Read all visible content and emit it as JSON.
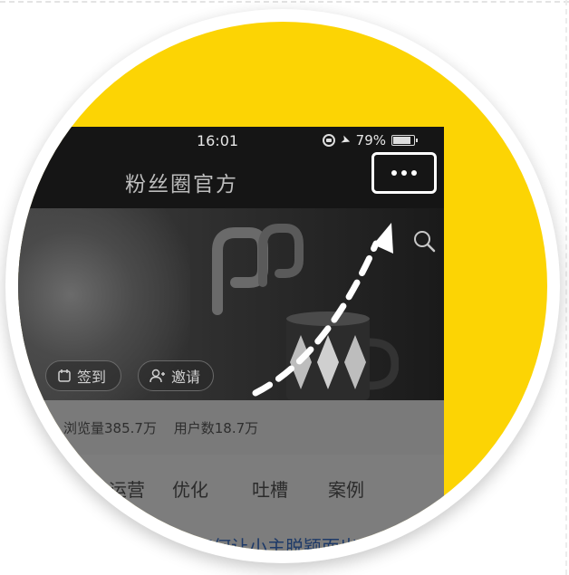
{
  "status_bar": {
    "time": "16:01",
    "battery": "79%"
  },
  "nav": {
    "title": "粉丝圈官方"
  },
  "actions": {
    "checkin": "签到",
    "invite": "邀请"
  },
  "stats": {
    "views": "浏览量385.7万",
    "users": "用户数18.7万"
  },
  "tabs": [
    "运营",
    "优化",
    "吐槽",
    "案例"
  ],
  "bottom_text": "如何让小主脱颖而出",
  "colors": {
    "background_circle": "#FCD404",
    "highlight": "#FFFFFF"
  },
  "icons": [
    "more-icon",
    "search-icon",
    "checkin-icon",
    "invite-icon",
    "location-arrow-icon",
    "battery-icon",
    "rotation-lock-icon"
  ]
}
